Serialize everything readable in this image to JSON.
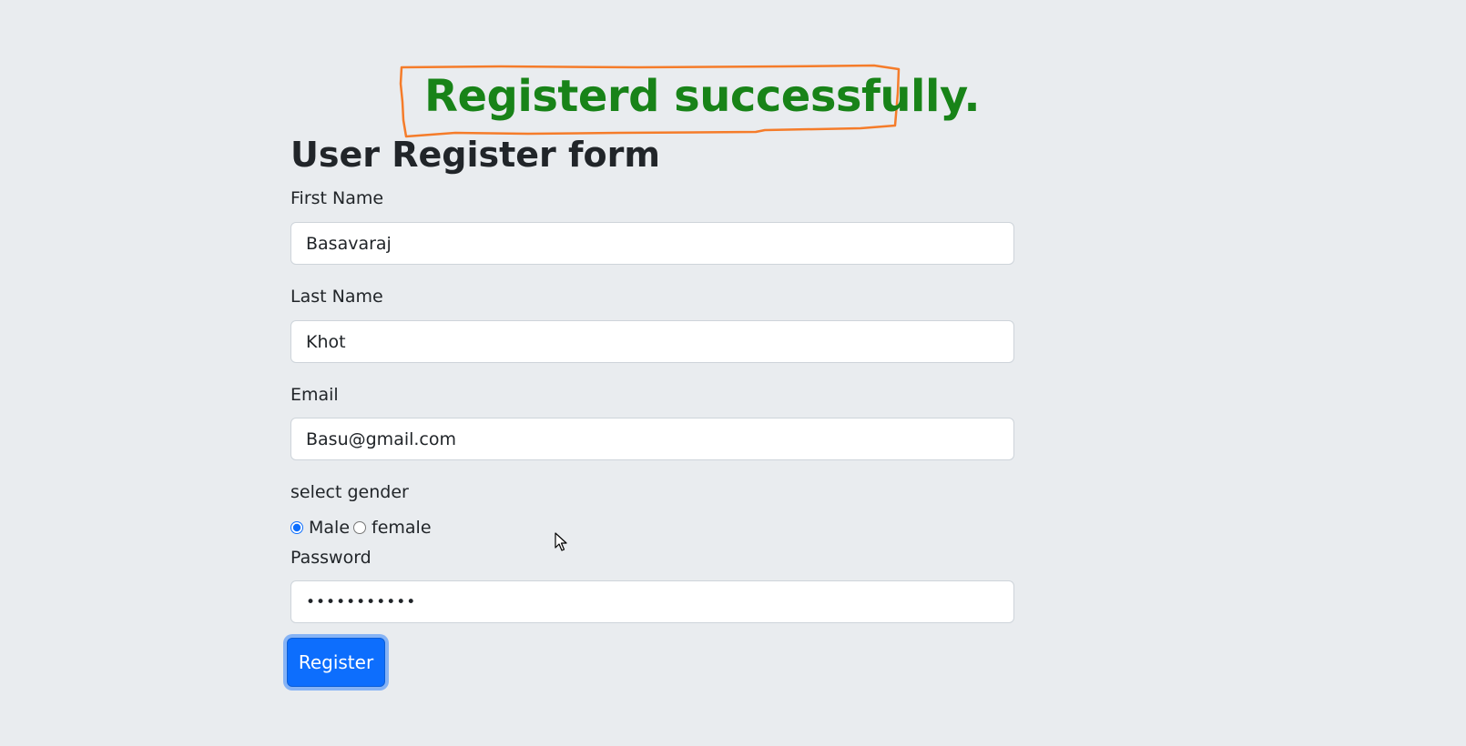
{
  "banner": {
    "message": "Registerd successfully.",
    "message_color": "#188318",
    "annotation_color": "#f57c2a"
  },
  "form": {
    "title": "User Register form",
    "first_name": {
      "label": "First Name",
      "value": "Basavaraj"
    },
    "last_name": {
      "label": "Last Name",
      "value": "Khot"
    },
    "email": {
      "label": "Email",
      "value": "Basu@gmail.com"
    },
    "gender": {
      "label": "select gender",
      "options": [
        {
          "label": "Male",
          "selected": true
        },
        {
          "label": "female",
          "selected": false
        }
      ]
    },
    "password": {
      "label": "Password",
      "value": "•••••••••••"
    },
    "submit_label": "Register"
  },
  "colors": {
    "background": "#e9ecef",
    "primary": "#0d6efd",
    "text": "#212529"
  },
  "icons": {
    "pointer": "mouse-pointer-icon"
  }
}
